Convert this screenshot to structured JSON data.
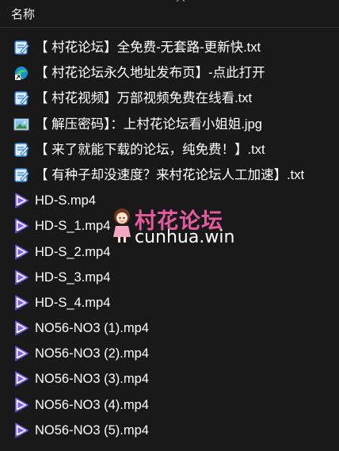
{
  "header": {
    "column_name": "名称",
    "sort_icon": "chevron-up-icon"
  },
  "files": [
    {
      "name": "【 村花论坛】全免费-无套路-更新快.txt",
      "icon": "text-file-icon"
    },
    {
      "name": "【 村花论坛永久地址发布页】-点此打开",
      "icon": "browser-shortcut-icon"
    },
    {
      "name": "【 村花视频】万部视频免费在线看.txt",
      "icon": "text-file-icon"
    },
    {
      "name": "【 解压密码】：上村花论坛看小姐姐.jpg",
      "icon": "image-file-icon"
    },
    {
      "name": "【 来了就能下载的论坛，纯免费！】.txt",
      "icon": "text-file-icon"
    },
    {
      "name": "【 有种子却没速度？来村花论坛人工加速】.txt",
      "icon": "text-file-icon"
    },
    {
      "name": "HD-S.mp4",
      "icon": "video-file-icon"
    },
    {
      "name": "HD-S_1.mp4",
      "icon": "video-file-icon"
    },
    {
      "name": "HD-S_2.mp4",
      "icon": "video-file-icon"
    },
    {
      "name": "HD-S_3.mp4",
      "icon": "video-file-icon"
    },
    {
      "name": "HD-S_4.mp4",
      "icon": "video-file-icon"
    },
    {
      "name": "NO56-NO3 (1).mp4",
      "icon": "video-file-icon"
    },
    {
      "name": "NO56-NO3 (2).mp4",
      "icon": "video-file-icon"
    },
    {
      "name": "NO56-NO3 (3).mp4",
      "icon": "video-file-icon"
    },
    {
      "name": "NO56-NO3 (4).mp4",
      "icon": "video-file-icon"
    },
    {
      "name": "NO56-NO3 (5).mp4",
      "icon": "video-file-icon"
    }
  ],
  "watermark": {
    "title": "村花论坛",
    "url": "cunhua.win"
  },
  "colors": {
    "background": "#191919",
    "text": "#ffffff",
    "watermark_pink": "#e65b9f",
    "video_icon": "#7b5cf0",
    "text_icon_blue": "#2f7fd6"
  }
}
